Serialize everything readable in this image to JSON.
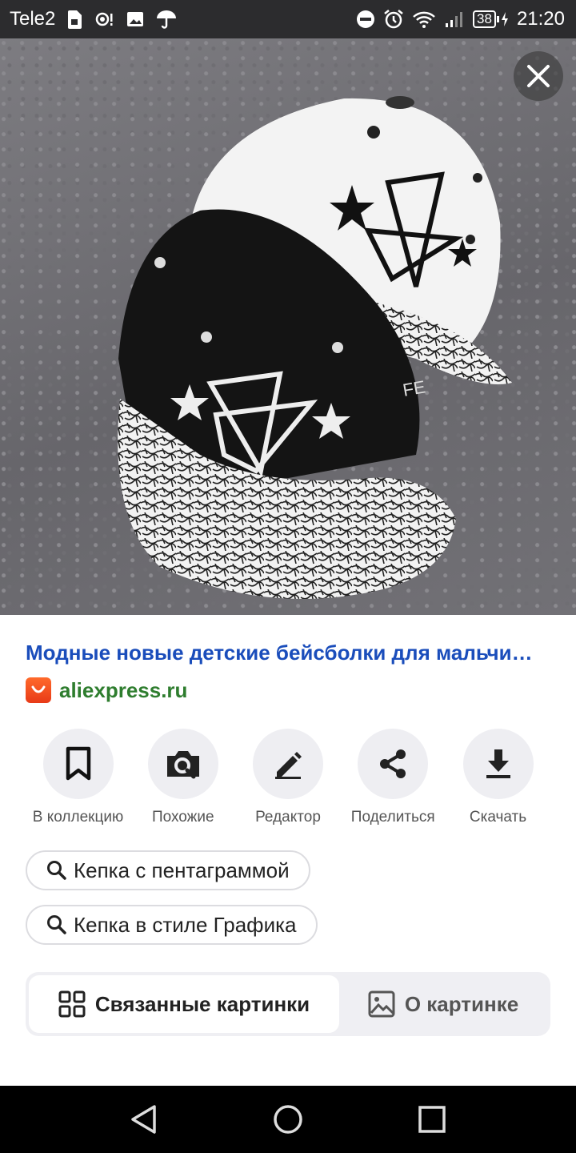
{
  "status_bar": {
    "carrier": "Tele2",
    "battery": "38",
    "time": "21:20",
    "icons_left": [
      "sim-card-icon",
      "hotspot-icon",
      "gallery-icon",
      "umbrella-icon"
    ],
    "icons_right": [
      "do-not-disturb-icon",
      "alarm-icon",
      "wifi-icon",
      "signal-icon",
      "battery-icon"
    ]
  },
  "image": {
    "subject": "two-baseball-caps-photo"
  },
  "result": {
    "title": "Модные новые детские бейсболки для мальчи…",
    "source": "aliexpress.ru"
  },
  "actions": [
    {
      "label": "В коллекцию",
      "icon": "bookmark-icon"
    },
    {
      "label": "Похожие",
      "icon": "camera-search-icon"
    },
    {
      "label": "Редактор",
      "icon": "pencil-icon"
    },
    {
      "label": "Поделиться",
      "icon": "share-icon"
    },
    {
      "label": "Скачать",
      "icon": "download-icon"
    }
  ],
  "suggestions": [
    {
      "text": "Кепка с пентаграммой",
      "icon": "search-icon"
    },
    {
      "text": "Кепка в стиле Графика",
      "icon": "search-icon"
    }
  ],
  "tabs": [
    {
      "label": "Связанные картинки",
      "icon": "grid-icon",
      "active": true
    },
    {
      "label": "О картинке",
      "icon": "image-icon",
      "active": false
    }
  ],
  "colors": {
    "title_link": "#1a4dbb",
    "source_text": "#2e7d2e",
    "action_bg": "#eeeef2",
    "tabs_bg": "#efeff3"
  }
}
